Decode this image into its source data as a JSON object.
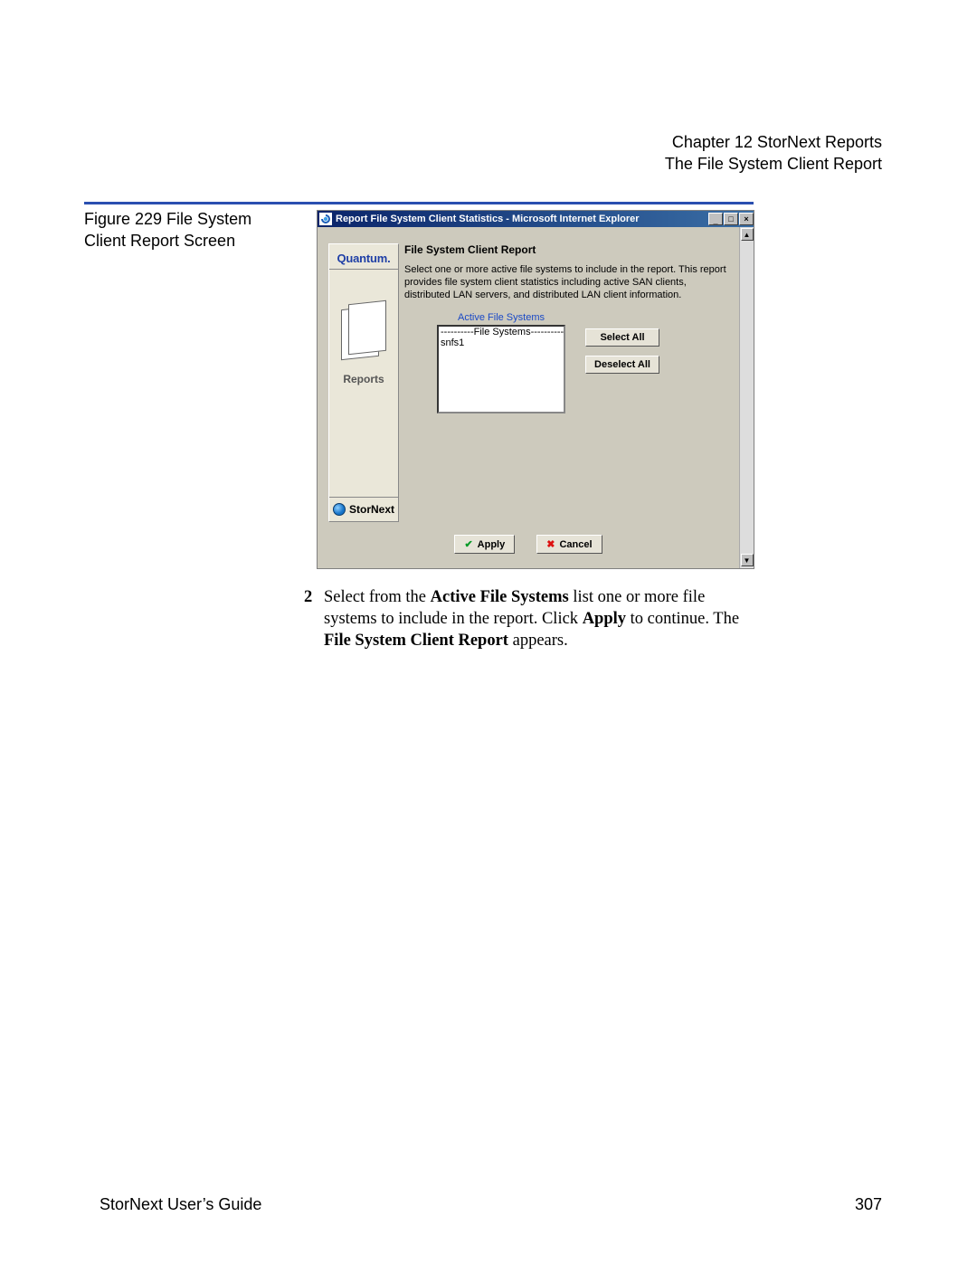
{
  "header": {
    "chapter": "Chapter 12  StorNext Reports",
    "subtitle": "The File System Client Report"
  },
  "caption": "Figure 229  File System Client Report Screen",
  "window": {
    "title": "Report File System Client Statistics - Microsoft Internet Explorer",
    "minimize": "_",
    "maximize": "□",
    "close": "×"
  },
  "sidebar": {
    "brand": "Quantum.",
    "reports_label": "Reports",
    "product": "StorNext"
  },
  "panel": {
    "title": "File System Client Report",
    "desc": "Select one or more active file systems to include in the report. This report provides file system client statistics including active SAN clients, distributed LAN servers, and distributed LAN client information.",
    "list_caption": "Active File Systems",
    "list_header": "----------File Systems----------",
    "items": [
      "snfs1"
    ],
    "select_all": "Select All",
    "deselect_all": "Deselect All",
    "apply": "Apply",
    "cancel": "Cancel"
  },
  "body": {
    "num": "2",
    "seg1": "Select from the ",
    "b1": "Active File Systems",
    "seg2": " list one or more file systems to include in the report. Click ",
    "b2": "Apply",
    "seg3": " to continue. The ",
    "b3": "File System Client Report",
    "seg4": " appears."
  },
  "footer": {
    "left": "StorNext User’s Guide",
    "right": "307"
  }
}
